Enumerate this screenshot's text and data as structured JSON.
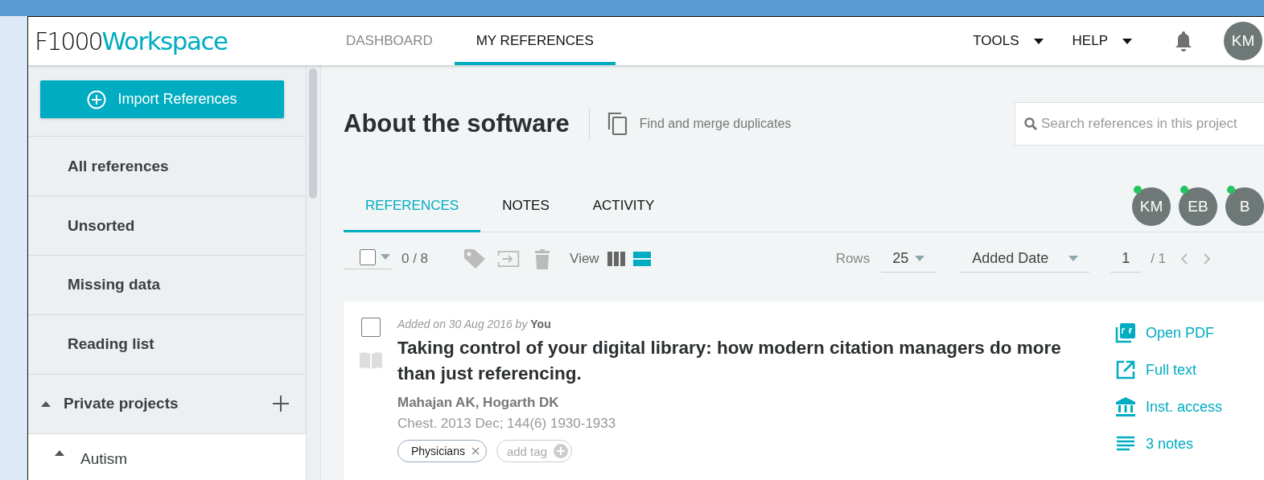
{
  "header": {
    "logo": {
      "prefix": "F1000",
      "name": "Workspace"
    },
    "nav": [
      {
        "label": "DASHBOARD",
        "selected": false
      },
      {
        "label": "MY REFERENCES",
        "selected": true
      }
    ],
    "menus": [
      {
        "label": "TOOLS"
      },
      {
        "label": "HELP"
      }
    ],
    "user_avatar": "KM"
  },
  "sidebar": {
    "import_button": "Import References",
    "items": [
      {
        "label": "All references"
      },
      {
        "label": "Unsorted"
      },
      {
        "label": "Missing data"
      },
      {
        "label": "Reading list"
      }
    ],
    "projects": {
      "label": "Private projects",
      "expanded": true,
      "children": [
        {
          "label": "Autism",
          "expanded": true
        }
      ]
    }
  },
  "project": {
    "title": "About the software",
    "merge_link": "Find and merge duplicates",
    "search": {
      "placeholder": "Search references in this project"
    },
    "tabs": [
      {
        "label": "REFERENCES",
        "selected": true
      },
      {
        "label": "NOTES",
        "selected": false
      },
      {
        "label": "ACTIVITY",
        "selected": false
      }
    ],
    "members": [
      {
        "initials": "KM",
        "online": true
      },
      {
        "initials": "EB",
        "online": true
      },
      {
        "initials": "B",
        "online": true
      }
    ]
  },
  "toolbar": {
    "select_all_checked": false,
    "selection_count": "0 / 8",
    "view_label": "View",
    "view_modes": [
      {
        "kind": "columns",
        "selected": false
      },
      {
        "kind": "rows",
        "selected": true
      }
    ],
    "rows_label": "Rows",
    "rows_value": "25",
    "sort_value": "Added Date",
    "page_value": "1",
    "page_total": "/ 1"
  },
  "references": [
    {
      "checked": false,
      "added": "Added on 30 Aug 2016 by **You**",
      "title": "Taking control of your digital library: how modern citation managers do more than just referencing.",
      "authors": "Mahajan AK, Hogarth DK",
      "journal": "Chest. 2013 Dec; 144(6) 1930-1933",
      "tags": [
        "Physicians"
      ],
      "add_tag": "add tag",
      "actions": [
        {
          "kind": "pdf",
          "label": "Open PDF"
        },
        {
          "kind": "fulltext",
          "label": "Full text"
        },
        {
          "kind": "access",
          "label": "Inst. access"
        },
        {
          "kind": "notes",
          "label": "3 notes"
        }
      ]
    }
  ]
}
